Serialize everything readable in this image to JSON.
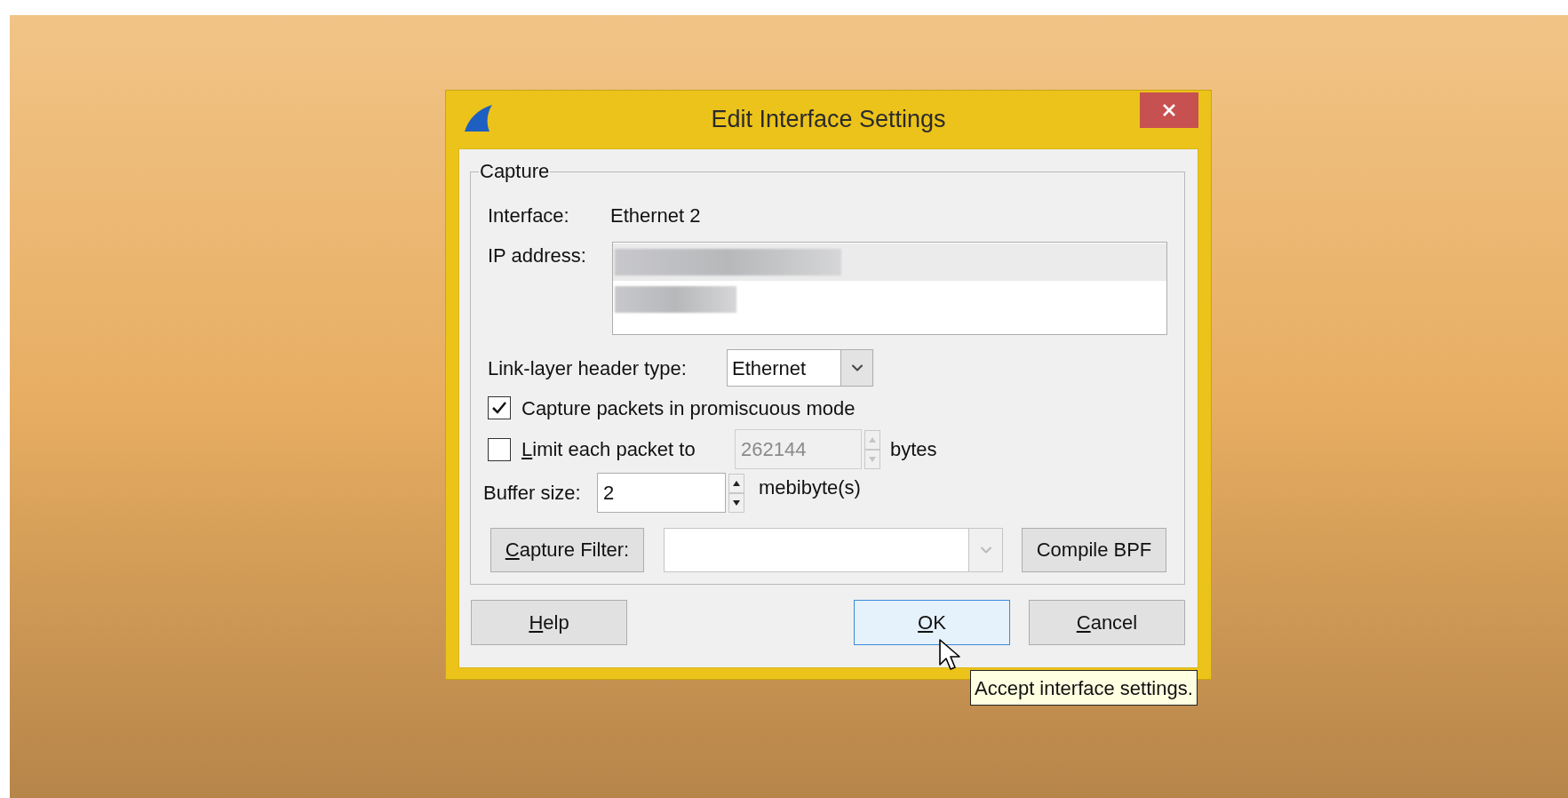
{
  "window": {
    "title": "Edit Interface Settings"
  },
  "capture": {
    "title": "Capture",
    "interface": {
      "label": "Interface:",
      "value": "Ethernet 2"
    },
    "ip_address": {
      "label": "IP address:",
      "entries": [
        {
          "selected": true
        },
        {
          "selected": false
        }
      ]
    },
    "link_layer": {
      "label": "Link-layer header type:",
      "value": "Ethernet"
    },
    "options": [
      {
        "kind": "checkbox",
        "label": "Capture packets in promiscuous mode",
        "checked": true,
        "accelerator": false
      },
      {
        "kind": "checkbox_spin",
        "label": "Limit each packet to",
        "checked": false,
        "accelerator": true,
        "value": "262144",
        "disabled": true,
        "unit": "bytes"
      }
    ],
    "buffer": {
      "label": "Buffer size:",
      "value": "2",
      "unit": "mebibyte(s)"
    },
    "capture_filter": {
      "button": "Capture Filter:",
      "accelerator": true,
      "compile": "Compile BPF"
    }
  },
  "buttons": [
    {
      "label": "Help",
      "accelerator": true,
      "focused": false
    },
    {
      "label": "OK",
      "accelerator": true,
      "focused": true
    },
    {
      "label": "Cancel",
      "accelerator": true,
      "focused": false
    }
  ],
  "tooltip": "Accept interface settings."
}
